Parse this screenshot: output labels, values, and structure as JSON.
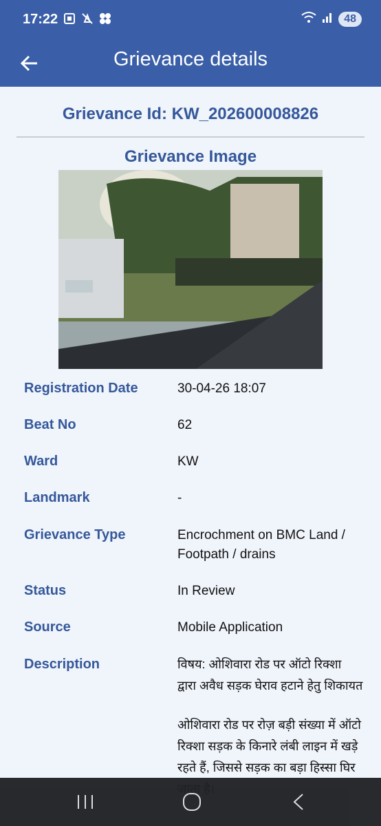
{
  "status_bar": {
    "time": "17:22",
    "battery": "48",
    "icons": [
      "screenshot-icon",
      "mute-icon",
      "pinwheel-icon",
      "wifi-icon",
      "signal-icon"
    ]
  },
  "app_bar": {
    "title": "Grievance details",
    "back_icon": "arrow-left-icon"
  },
  "grievance_id": "Grievance Id: KW_202600008826",
  "image_section": {
    "title": "Grievance Image"
  },
  "details": [
    {
      "label": "Registration Date",
      "value": "30-04-26  18:07"
    },
    {
      "label": "Beat No",
      "value": "62"
    },
    {
      "label": "Ward",
      "value": "KW"
    },
    {
      "label": "Landmark",
      "value": "-"
    },
    {
      "label": "Grievance Type",
      "value": "Encrochment on BMC Land / Footpath / drains"
    },
    {
      "label": "Status",
      "value": "In Review"
    },
    {
      "label": "Source",
      "value": "Mobile Application"
    },
    {
      "label": "Description",
      "value": ""
    }
  ],
  "description": {
    "para1": "विषय: ओशिवारा रोड पर ऑटो रिक्शा द्वारा अवैध सड़क घेराव हटाने हेतु शिकायत",
    "para2": "ओशिवारा रोड पर रोज़ बड़ी संख्या में ऑटो रिक्शा सड़क के किनारे लंबी लाइन में खड़े रहते हैं, जिससे सड़क का बड़ा हिस्सा घिर जाता है।"
  },
  "nav_bar": {
    "icons": [
      "recent-apps-icon",
      "home-icon",
      "back-nav-icon"
    ]
  },
  "colors": {
    "primary": "#3a5fa8",
    "label": "#34589a",
    "background": "#f0f4fb"
  }
}
